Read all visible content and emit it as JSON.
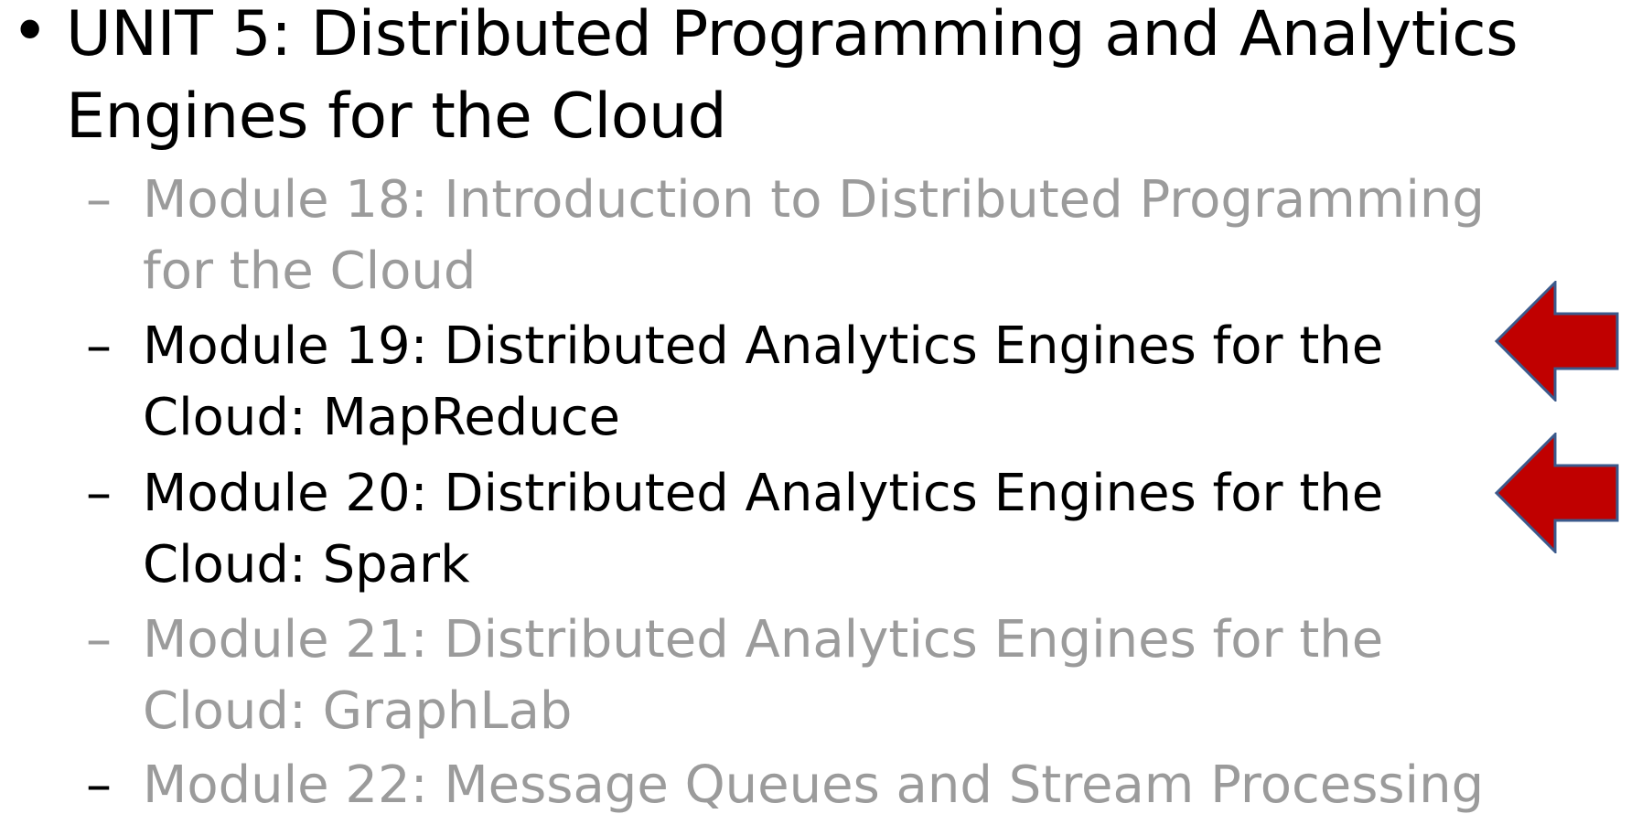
{
  "slide": {
    "unit_title_line1": "UNIT 5: Distributed Programming and Analytics",
    "unit_title_line2": "Engines for the Cloud",
    "bullet": "•",
    "dash": "–",
    "modules": [
      {
        "line1": "Module 18: Introduction to Distributed Programming",
        "line2": "for the Cloud",
        "state": "faded"
      },
      {
        "line1": "Module 19: Distributed Analytics Engines for the",
        "line2": "Cloud: MapReduce",
        "state": "active"
      },
      {
        "line1": "Module 20: Distributed Analytics Engines for the",
        "line2": "Cloud: Spark",
        "state": "active"
      },
      {
        "line1": "Module 21: Distributed Analytics Engines for the",
        "line2": "Cloud: GraphLab",
        "state": "faded"
      },
      {
        "line1": "Module 22: Message Queues and Stream Processing",
        "line2": "",
        "state": "faded"
      }
    ],
    "arrow_icon": "left-arrow-icon",
    "colors": {
      "text_active": "#000000",
      "text_faded": "#9b9b9b",
      "arrow_fill": "#c00000",
      "arrow_stroke": "#3b5a8c"
    }
  }
}
